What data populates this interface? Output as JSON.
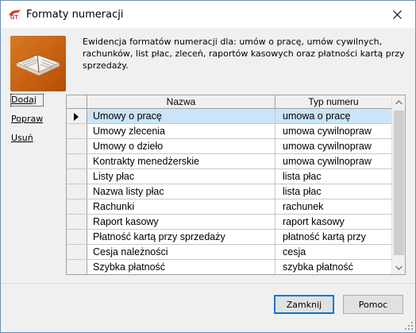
{
  "window": {
    "title": "Formaty numeracji",
    "app_icon": "gt-app-icon",
    "close_glyph": "✕"
  },
  "header": {
    "logo_icon": "book-icon",
    "description": "Ewidencja formatów numeracji dla: umów o pracę, umów cywilnych, rachunków, list płac, zleceń, raportów kasowych oraz płatności kartą przy sprzedaży."
  },
  "actions": {
    "add_label": "Dodaj",
    "edit_label": "Popraw",
    "delete_label": "Usuń"
  },
  "grid": {
    "columns": [
      "Nazwa",
      "Typ numeru"
    ],
    "selected_index": 0,
    "rows": [
      {
        "name": "Umowy o pracę",
        "type": "umowa o pracę"
      },
      {
        "name": "Umowy zlecenia",
        "type": "umowa cywilnopraw"
      },
      {
        "name": "Umowy o dzieło",
        "type": "umowa cywilnopraw"
      },
      {
        "name": "Kontrakty menedżerskie",
        "type": "umowa cywilnopraw"
      },
      {
        "name": "Listy płac",
        "type": "lista płac"
      },
      {
        "name": "Nazwa listy płac",
        "type": "lista płac"
      },
      {
        "name": "Rachunki",
        "type": "rachunek"
      },
      {
        "name": "Raport kasowy",
        "type": "raport kasowy"
      },
      {
        "name": "Płatność kartą przy sprzedaży",
        "type": "płatność kartą przy"
      },
      {
        "name": "Cesja należności",
        "type": "cesja"
      },
      {
        "name": "Szybka płatność",
        "type": "szybka płatność"
      }
    ]
  },
  "footer": {
    "close_label": "Zamknij",
    "help_label": "Pomoc"
  },
  "colors": {
    "selection": "#cce4f7",
    "logo_orange": "#c65f10",
    "default_button_border": "#0078d7"
  }
}
